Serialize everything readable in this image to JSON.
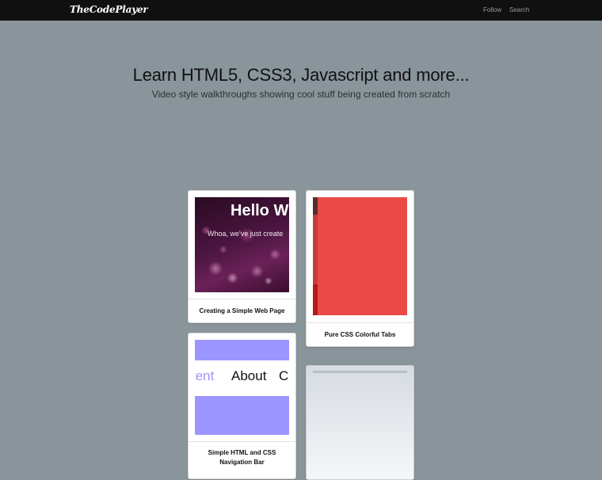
{
  "header": {
    "brand": "TheCodePlayer",
    "nav": [
      "Follow",
      "Search"
    ]
  },
  "hero": {
    "title": "Learn HTML5, CSS3, Javascript and more...",
    "subtitle": "Video style walkthroughs showing cool stuff being created from scratch"
  },
  "cards": [
    {
      "title": "Creating a Simple Web Page",
      "preview_heading": "Hello W",
      "preview_text": "Whoa, we've just create"
    },
    {
      "title": "Pure CSS Colorful Tabs"
    },
    {
      "title_line1": "Simple HTML and CSS",
      "title_line2": "Navigation Bar",
      "preview_items": [
        "tent",
        "About",
        "C"
      ]
    },
    {
      "title": ""
    }
  ],
  "colors": {
    "page_bg": "#89959a",
    "topbar_bg": "#101010",
    "tabs_red": "#ea4a45",
    "nav_purple": "#9b96ff"
  }
}
